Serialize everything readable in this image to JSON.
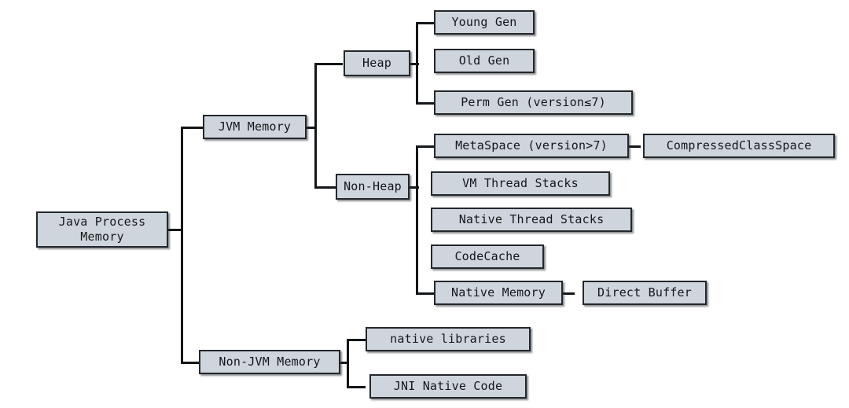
{
  "diagram": {
    "title": "Java Process Memory breakdown tree",
    "colors": {
      "node_fill": "#ced5dc",
      "node_border": "#24282c",
      "connector": "#14171a",
      "background": "#ffffff",
      "text": "#15181b"
    },
    "nodes": {
      "root": "Java Process\nMemory",
      "jvm_memory": "JVM Memory",
      "non_jvm_memory": "Non-JVM Memory",
      "heap": "Heap",
      "non_heap": "Non-Heap",
      "young_gen": "Young Gen",
      "old_gen": "Old Gen",
      "perm_gen": "Perm Gen (version≤7)",
      "metaspace": "MetaSpace (version>7)",
      "compressed_class_space": "CompressedClassSpace",
      "vm_thread_stacks": "VM Thread Stacks",
      "native_thread_stacks": "Native Thread Stacks",
      "code_cache": "CodeCache",
      "native_memory": "Native Memory",
      "direct_buffer": "Direct Buffer",
      "native_libraries": "native libraries",
      "jni_native_code": "JNI Native Code"
    }
  }
}
